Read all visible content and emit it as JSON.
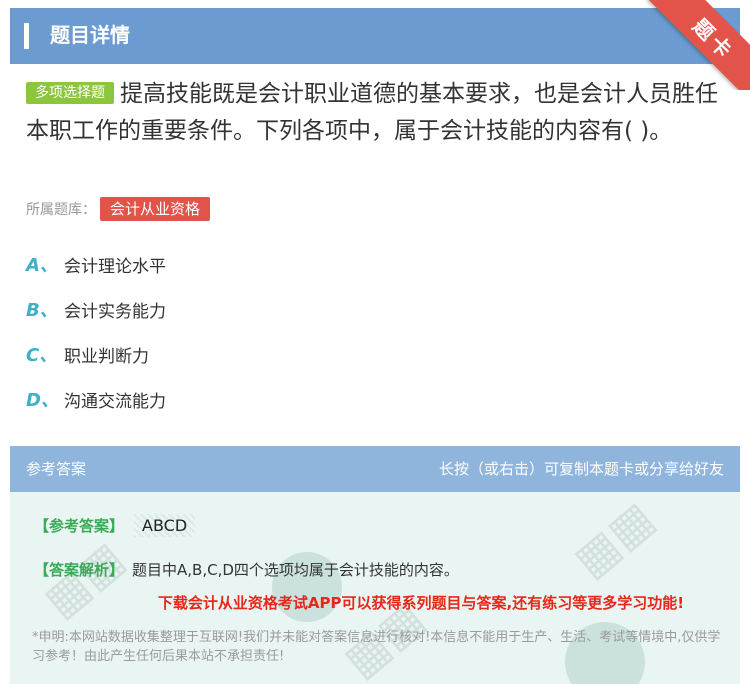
{
  "header": {
    "title": "题目详情",
    "ribbon": "题卡"
  },
  "question": {
    "type_label": "多项选择题",
    "text": "提高技能既是会计职业道德的基本要求，也是会计人员胜任本职工作的重要条件。下列各项中，属于会计技能的内容有(   )。"
  },
  "bank": {
    "label": "所属题库：",
    "tag": "会计从业资格"
  },
  "options": [
    {
      "letter": "A、",
      "text": "会计理论水平"
    },
    {
      "letter": "B、",
      "text": "会计实务能力"
    },
    {
      "letter": "C、",
      "text": "职业判断力"
    },
    {
      "letter": "D、",
      "text": "沟通交流能力"
    }
  ],
  "answer_section": {
    "title": "参考答案",
    "hint": "长按（或右击）可复制本题卡或分享给好友",
    "answer_label": "【参考答案】",
    "answer_value": "ABCD",
    "explanation_label": "【答案解析】",
    "explanation_text": "题目中A,B,C,D四个选项均属于会计技能的内容。",
    "promo": "下载会计从业资格考试APP可以获得系列题目与答案,还有练习等更多学习功能!",
    "disclaimer": "*申明:本网站数据收集整理于互联网!我们并未能对答案信息进行核对!本信息不能用于生产、生活、考试等情境中,仅供学习参考！由此产生任何后果本站不承担责任!"
  },
  "colors": {
    "header_bg": "#6b9bd0",
    "ribbon": "#e2534a",
    "type_badge": "#8cc63f",
    "option_letter": "#3fb0c8",
    "answer_label": "#3aaa58",
    "promo": "#e8261a"
  }
}
